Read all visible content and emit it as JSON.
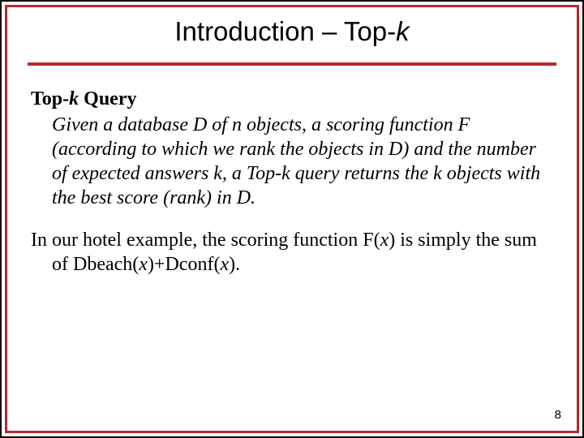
{
  "title": {
    "pre": "Introduction – Top-",
    "k": "k"
  },
  "subhead": {
    "pre": "Top-",
    "k": "k",
    "post": " Query"
  },
  "definition": "Given a database D of n objects, a scoring function F (according to which we rank the objects in D) and the number of expected answers k,  a Top-k query returns the k objects with the best score (rank) in D.",
  "example": {
    "line_pre": "In our hotel example, the scoring function F(",
    "x1": "x",
    "mid1": ") is simply the sum of Dbeach(",
    "x2": "x",
    "mid2": ")+Dconf(",
    "x3": "x",
    "end": ")."
  },
  "page_number": "8"
}
